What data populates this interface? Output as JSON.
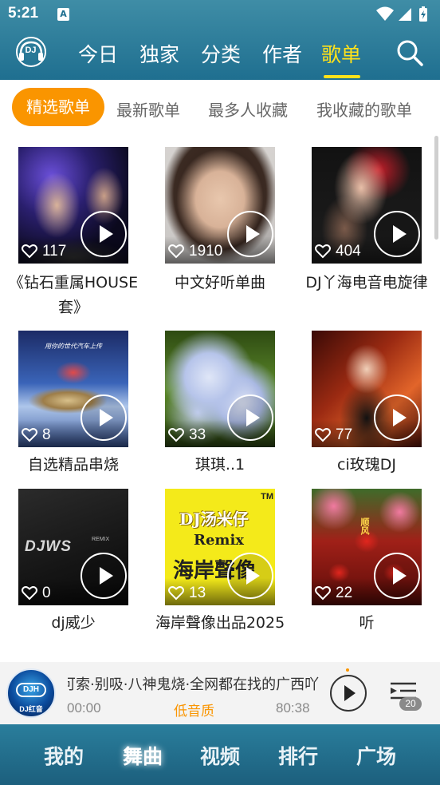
{
  "status_bar": {
    "time": "5:21",
    "notification_icon": "A"
  },
  "nav": {
    "logo_text": "DJ",
    "tabs": [
      {
        "label": "今日",
        "active": false
      },
      {
        "label": "独家",
        "active": false
      },
      {
        "label": "分类",
        "active": false
      },
      {
        "label": "作者",
        "active": false
      },
      {
        "label": "歌单",
        "active": true
      }
    ],
    "search_icon": "search-icon"
  },
  "subtabs": [
    {
      "label": "精选歌单",
      "active": true
    },
    {
      "label": "最新歌单",
      "active": false
    },
    {
      "label": "最多人收藏",
      "active": false
    },
    {
      "label": "我收藏的歌单",
      "active": false
    }
  ],
  "playlists": [
    {
      "title": "《钻石重属HOUSE套》",
      "likes": "117"
    },
    {
      "title": "中文好听单曲",
      "likes": "1910"
    },
    {
      "title": "DJ丫海电音电旋律",
      "likes": "404"
    },
    {
      "title": "自选精品串烧",
      "likes": "8"
    },
    {
      "title": "琪琪..1",
      "likes": "33"
    },
    {
      "title": "ci玫瑰DJ",
      "likes": "77"
    },
    {
      "title": "dj威少",
      "likes": "0"
    },
    {
      "title": "海岸聲像出品2025",
      "likes": "13"
    },
    {
      "title": "听",
      "likes": "22"
    }
  ],
  "artwork_text": {
    "djws": "DJWS",
    "djws_small": "REMIX",
    "tm_tag": "TM",
    "tm_line1": "DJ汤米仔",
    "tm_line2": "Remix",
    "tm_line3": "海岸聲像",
    "car_banner": "用你的世代汽车上传",
    "lantern": "顺风"
  },
  "player": {
    "art_logo": "DJH",
    "art_sub": "DJ红音",
    "title": "可索·别吸·八神鬼烧·全网都在找的广西吖",
    "current_time": "00:00",
    "quality": "低音质",
    "duration": "80:38",
    "queue_count": "20"
  },
  "bottom_tabs": [
    {
      "label": "我的",
      "active": false
    },
    {
      "label": "舞曲",
      "active": true
    },
    {
      "label": "视频",
      "active": false
    },
    {
      "label": "排行",
      "active": false
    },
    {
      "label": "广场",
      "active": false
    }
  ],
  "colors": {
    "accent_orange": "#fa9500",
    "nav_active": "#ffe21a",
    "header_blue": "#1f6f90"
  }
}
